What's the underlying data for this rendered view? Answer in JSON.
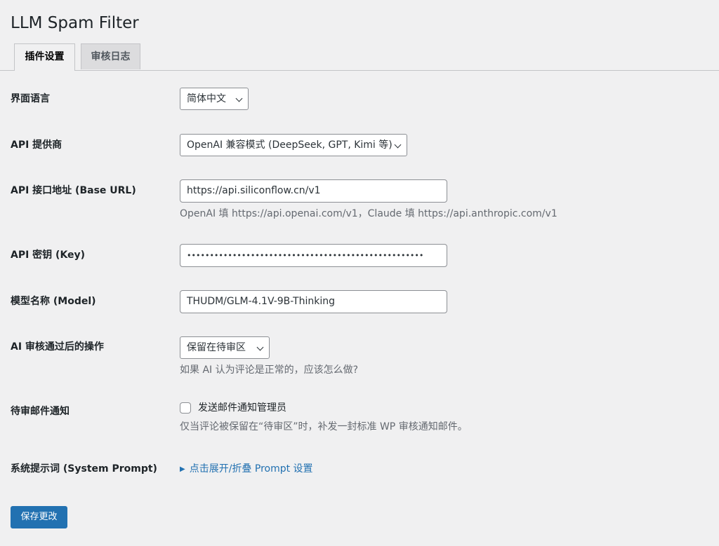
{
  "page": {
    "title": "LLM Spam Filter"
  },
  "tabs": [
    {
      "label": "插件设置",
      "active": true
    },
    {
      "label": "审核日志",
      "active": false
    }
  ],
  "fields": {
    "language": {
      "label": "界面语言",
      "value": "简体中文"
    },
    "provider": {
      "label": "API 提供商",
      "value": "OpenAI 兼容模式 (DeepSeek, GPT, Kimi 等)"
    },
    "base_url": {
      "label": "API 接口地址 (Base URL)",
      "value": "https://api.siliconflow.cn/v1",
      "description": "OpenAI 填 https://api.openai.com/v1，Claude 填 https://api.anthropic.com/v1"
    },
    "api_key": {
      "label": "API 密钥 (Key)",
      "value": "••••••••••••••••••••••••••••••••••••••••••••••••••••"
    },
    "model": {
      "label": "模型名称 (Model)",
      "value": "THUDM/GLM-4.1V-9B-Thinking"
    },
    "pass_action": {
      "label": "AI 审核通过后的操作",
      "value": "保留在待审区",
      "description": "如果 AI 认为评论是正常的，应该怎么做?"
    },
    "notify": {
      "label": "待审邮件通知",
      "checkbox_label": "发送邮件通知管理员",
      "checked": false,
      "description": "仅当评论被保留在“待审区”时，补发一封标准 WP 审核通知邮件。"
    },
    "system_prompt": {
      "label": "系统提示词 (System Prompt)",
      "toggle_text": "点击展开/折叠 Prompt 设置"
    }
  },
  "actions": {
    "save_label": "保存更改"
  },
  "colors": {
    "accent": "#2271b1",
    "background": "#f0f0f1",
    "description_text": "#646970"
  }
}
